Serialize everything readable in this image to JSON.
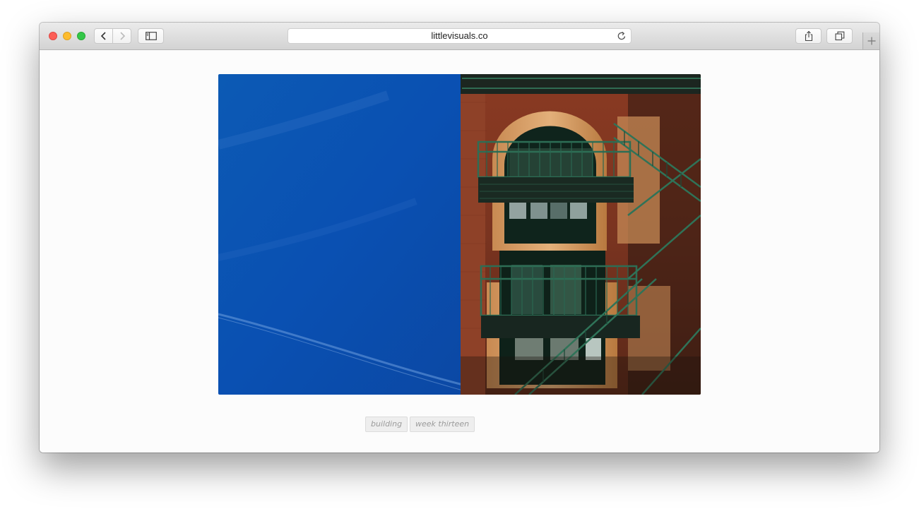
{
  "browser": {
    "address_bar": {
      "url": "littlevisuals.co"
    },
    "toolbar": {
      "back_icon": "chevron-left-icon",
      "forward_icon": "chevron-right-icon",
      "sidebar_icon": "sidebar-icon",
      "share_icon": "share-icon",
      "tabs_icon": "tabs-overview-icon",
      "reload_icon": "reload-icon",
      "new_tab_icon": "plus-icon"
    },
    "traffic_lights": {
      "close": "#fc5f57",
      "minimize": "#fdbc2e",
      "maximize": "#33c748"
    }
  },
  "page": {
    "photo": {
      "subject": "fire escape on a red brick building against a blue sky"
    },
    "tags": [
      {
        "label": "building"
      },
      {
        "label": "week thirteen"
      }
    ]
  }
}
